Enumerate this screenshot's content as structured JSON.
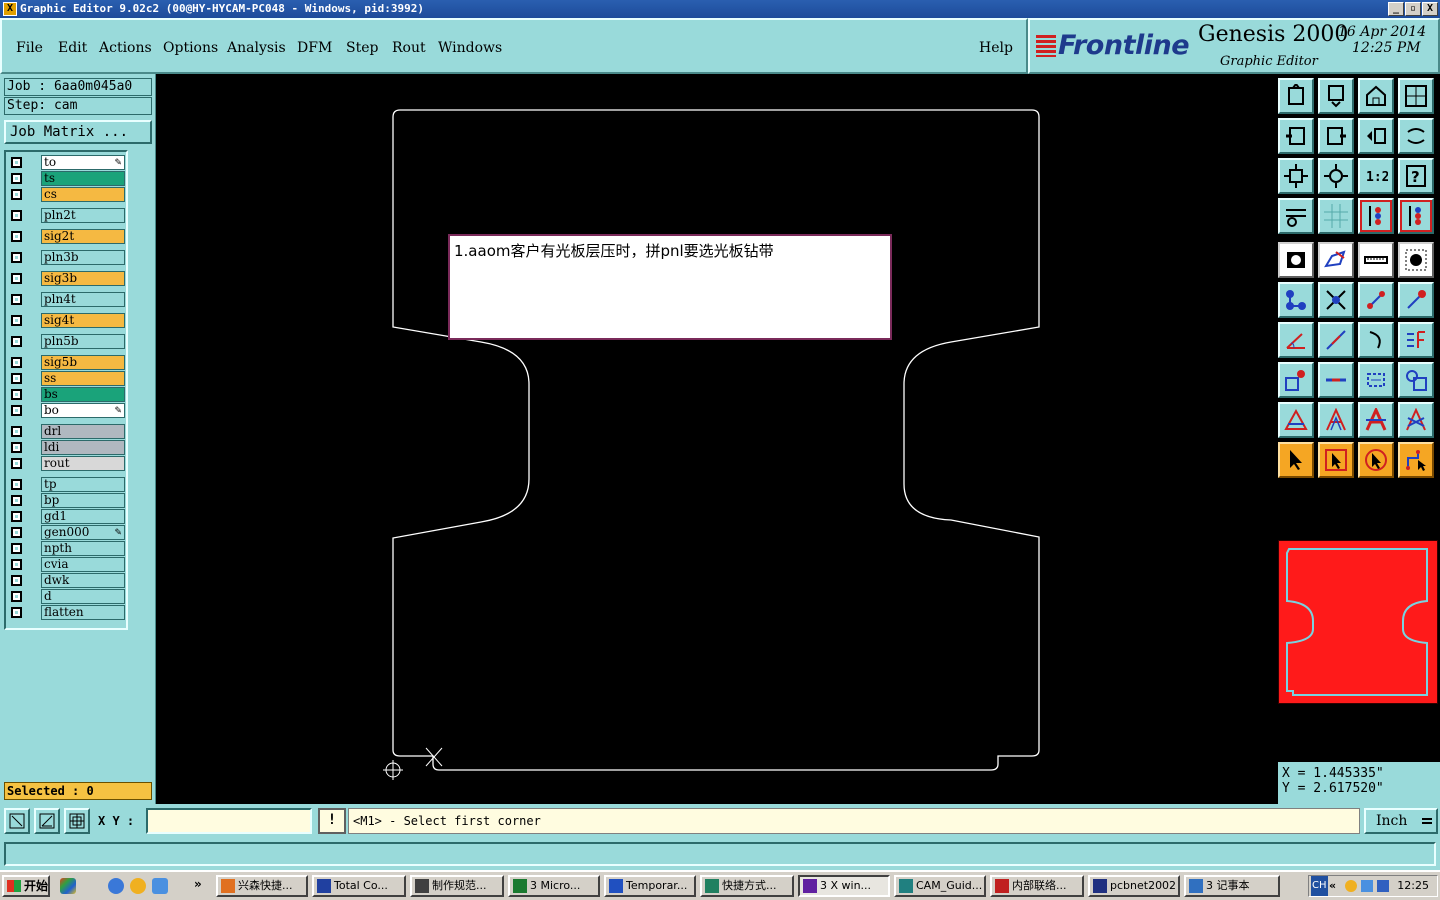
{
  "window": {
    "title": "Graphic Editor 9.02c2  (00@HY-HYCAM-PC048 - Windows, pid:3992)",
    "app_icon": "X",
    "controls": [
      "_",
      "▫",
      "X"
    ]
  },
  "menu": {
    "file": "File",
    "edit": "Edit",
    "actions": "Actions",
    "options": "Options",
    "analysis": "Analysis",
    "dfm": "DFM",
    "step": "Step",
    "rout": "Rout",
    "windows": "Windows",
    "help": "Help"
  },
  "brand": {
    "logo": "Frontline",
    "product": "Genesis 2000",
    "subtitle": "Graphic Editor",
    "date": "16 Apr 2014",
    "time": "12:25 PM"
  },
  "job": {
    "job_label": "Job : 6aa0m045a0",
    "step_label": "Step: cam",
    "matrix_button": "Job Matrix ..."
  },
  "layers": [
    {
      "name": "to",
      "color": "#ffffff",
      "edit": true
    },
    {
      "name": "ts",
      "color": "#1aa37a",
      "edit": false
    },
    {
      "name": "cs",
      "color": "#f5b942",
      "edit": false
    },
    {
      "name": "pln2t",
      "color": "#99dada",
      "edit": false
    },
    {
      "name": "sig2t",
      "color": "#f5b942",
      "edit": false
    },
    {
      "name": "pln3b",
      "color": "#99dada",
      "edit": false
    },
    {
      "name": "sig3b",
      "color": "#f5b942",
      "edit": false
    },
    {
      "name": "pln4t",
      "color": "#99dada",
      "edit": false
    },
    {
      "name": "sig4t",
      "color": "#f5b942",
      "edit": false
    },
    {
      "name": "pln5b",
      "color": "#99dada",
      "edit": false
    },
    {
      "name": "sig5b",
      "color": "#f5b942",
      "edit": false
    },
    {
      "name": "ss",
      "color": "#f5b942",
      "edit": false
    },
    {
      "name": "bs",
      "color": "#1aa37a",
      "edit": false
    },
    {
      "name": "bo",
      "color": "#ffffff",
      "edit": true
    },
    {
      "name": "drl",
      "color": "#b0b8c0",
      "edit": false
    },
    {
      "name": "ldi",
      "color": "#b0b8c0",
      "edit": false
    },
    {
      "name": "rout",
      "color": "#d8d8d8",
      "edit": false
    },
    {
      "name": "tp",
      "color": "#99dada",
      "edit": false
    },
    {
      "name": "bp",
      "color": "#99dada",
      "edit": false
    },
    {
      "name": "gd1",
      "color": "#99dada",
      "edit": false
    },
    {
      "name": "gen000",
      "color": "#99dada",
      "edit": true
    },
    {
      "name": "npth",
      "color": "#99dada",
      "edit": false
    },
    {
      "name": "cvia",
      "color": "#99dada",
      "edit": false
    },
    {
      "name": "dwk",
      "color": "#99dada",
      "edit": false
    },
    {
      "name": "d",
      "color": "#99dada",
      "edit": false
    },
    {
      "name": "flatten",
      "color": "#99dada",
      "edit": false
    }
  ],
  "selected_label": "Selected : 0",
  "canvas": {
    "note": "1.aaom客户有光板层压时，拼pnl要选光板钻带",
    "background": "#000000",
    "outline_color": "#ffffff"
  },
  "toolbar": {
    "icons": [
      "zoom-home-icon",
      "zoom-in-icon",
      "home-icon",
      "window-split-icon",
      "pan-left-icon",
      "pan-right-icon",
      "undo-icon",
      "redo-icon",
      "fit-all-icon",
      "fit-selected-icon",
      "ratio-1-2-icon",
      "help-icon",
      "settings-icon",
      "grid-icon",
      "layer-red-icon",
      "layer-select-icon",
      "pad-icon",
      "rect-shape-icon",
      "ruler-icon",
      "circle-icon",
      "node-icon",
      "intersection-icon",
      "connect-points-icon",
      "add-point-icon",
      "angle-icon",
      "line-icon",
      "arc-icon",
      "split-icon",
      "snap-icon",
      "midline-icon",
      "measure-icon",
      "shapes-icon",
      "triangle-icon",
      "text-a-icon",
      "text-a-outline-icon",
      "text-a-cross-icon",
      "pointer-icon",
      "pointer-box-icon",
      "pointer-circle-icon",
      "pointer-path-icon"
    ]
  },
  "minimap": {
    "fill": "#ff1a1a",
    "outline": "#79d3e0"
  },
  "coords": {
    "x": "X = 1.445335\"",
    "y": "Y = 2.617520\""
  },
  "command": {
    "xy_label": "X Y :",
    "xy_value": "",
    "excl": "!",
    "status": "<M1> - Select first corner",
    "unit": "Inch"
  },
  "taskbar": {
    "start": "开始",
    "quicklaunch_more": "»",
    "tasks": [
      {
        "label": "兴森快捷...",
        "icon_color": "#e07020"
      },
      {
        "label": "Total Co...",
        "icon_color": "#2040a0"
      },
      {
        "label": "制作规范...",
        "icon_color": "#404040"
      },
      {
        "label": "3 Micro...",
        "icon_color": "#1a7a30"
      },
      {
        "label": "Temporar...",
        "icon_color": "#2050c0"
      },
      {
        "label": "快捷方式...",
        "icon_color": "#208060"
      },
      {
        "label": "3 X win...",
        "icon_color": "#6020a0"
      },
      {
        "label": "CAM_Guid...",
        "icon_color": "#208080"
      },
      {
        "label": "内部联络...",
        "icon_color": "#c02020"
      },
      {
        "label": "pcbnet2002",
        "icon_color": "#203080"
      },
      {
        "label": "3 记事本",
        "icon_color": "#3070c0"
      }
    ],
    "tray_lang": "CH",
    "tray_more": "«",
    "clock": "12:25"
  }
}
